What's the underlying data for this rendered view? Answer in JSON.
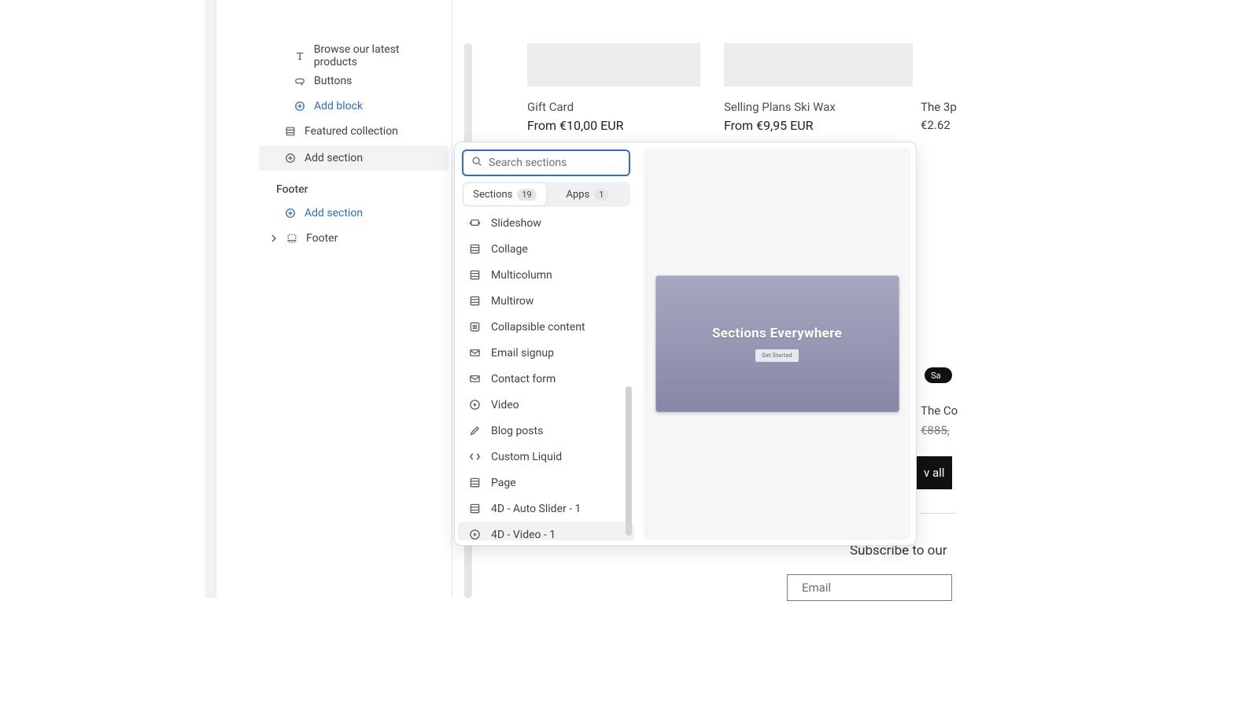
{
  "sidebar": {
    "items": [
      {
        "label": "Browse our latest products",
        "icon": "text-icon",
        "indent": "indent2"
      },
      {
        "label": "Buttons",
        "icon": "buttons-icon",
        "indent": "indent2"
      },
      {
        "label": "Add block",
        "icon": "plus-circle-icon",
        "indent": "indent2",
        "link": true
      },
      {
        "label": "Featured collection",
        "icon": "section-icon",
        "indent": "indent1"
      },
      {
        "label": "Add section",
        "icon": "plus-circle-icon",
        "indent": "indent1",
        "active": true
      }
    ],
    "footer_heading": "Footer",
    "footer_items": [
      {
        "label": "Add section",
        "icon": "plus-circle-icon",
        "link": true
      },
      {
        "label": "Footer",
        "icon": "footer-icon",
        "caret": true
      }
    ]
  },
  "products": {
    "p1": {
      "title": "Gift Card",
      "price": "From €10,00 EUR"
    },
    "p2": {
      "title": "Selling Plans Ski Wax",
      "price": "From €9,95 EUR"
    },
    "p3": {
      "title_cut": "The 3p",
      "price_cut": "€2.62"
    },
    "p4": {
      "title_cut": "The Co",
      "strike_cut": "€885,",
      "sale_cut": "Sa"
    },
    "viewall_cut": "v all"
  },
  "subscribe": {
    "heading_cut": "Subscribe to our",
    "email_placeholder": "Email"
  },
  "popover": {
    "search_placeholder": "Search sections",
    "tabs": {
      "sections": {
        "label": "Sections",
        "count": "19"
      },
      "apps": {
        "label": "Apps",
        "count": "1"
      }
    },
    "options": [
      {
        "label": "Slideshow",
        "icon": "slideshow-icon"
      },
      {
        "label": "Collage",
        "icon": "section-icon"
      },
      {
        "label": "Multicolumn",
        "icon": "section-icon"
      },
      {
        "label": "Multirow",
        "icon": "section-icon"
      },
      {
        "label": "Collapsible content",
        "icon": "collapsible-icon"
      },
      {
        "label": "Email signup",
        "icon": "mail-icon"
      },
      {
        "label": "Contact form",
        "icon": "mail-icon"
      },
      {
        "label": "Video",
        "icon": "play-icon"
      },
      {
        "label": "Blog posts",
        "icon": "pencil-icon"
      },
      {
        "label": "Custom Liquid",
        "icon": "code-icon"
      },
      {
        "label": "Page",
        "icon": "section-icon"
      },
      {
        "label": "4D - Auto Slider - 1",
        "icon": "section-icon"
      },
      {
        "label": "4D - Video - 1",
        "icon": "play-icon",
        "hover": true
      }
    ],
    "preview": {
      "title": "Sections Everywhere",
      "button": "Get Started"
    }
  }
}
